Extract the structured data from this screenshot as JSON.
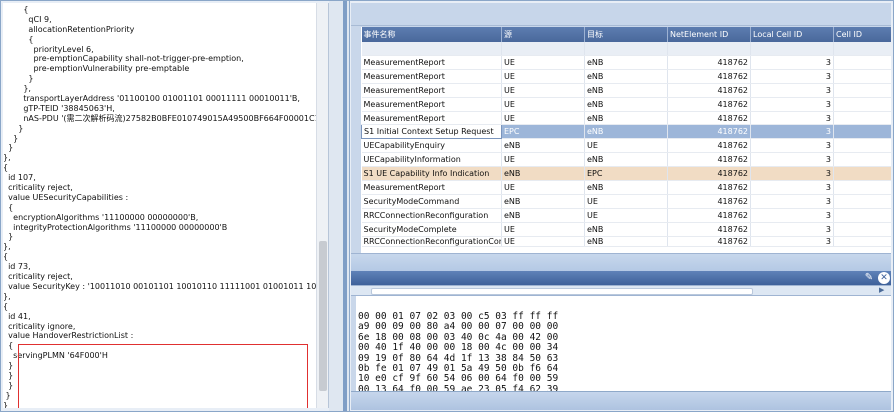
{
  "code_lines": [
    "        {",
    "          qCI 9,",
    "          allocationRetentionPriority",
    "          {",
    "            priorityLevel 6,",
    "            pre-emptionCapability shall-not-trigger-pre-emption,",
    "            pre-emptionVulnerability pre-emptable",
    "          }",
    "        },",
    "        transportLayerAddress '01100100 01001101 00011111 00010011'B,",
    "        gTP-TEID '38845063'H,",
    "        nAS-PDU '(需二次解析码流)27582B0BFE010749015A49500BF664F00001C11",
    "      }",
    "    }",
    "  }",
    "},",
    "{",
    "  id 107,",
    "  criticality reject,",
    "  value UESecurityCapabilities :",
    "  {",
    "    encryptionAlgorithms '11100000 00000000'B,",
    "    integrityProtectionAlgorithms '11100000 00000000'B",
    "  }",
    "},",
    "{",
    "  id 73,",
    "  criticality reject,",
    "  value SecurityKey : '10011010 00101101 10010110 11111001 01001011 101110",
    "},",
    "{",
    "  id 41,",
    "  criticality ignore,",
    "  value HandoverRestrictionList :",
    "  {",
    "    servingPLMN '64F000'H",
    "  }",
    "  }",
    "  }",
    " }",
    "}"
  ],
  "grid": {
    "headers": [
      "事件名称",
      "源",
      "目标",
      "NetElement ID",
      "Local Cell ID",
      "Cell ID"
    ],
    "rows": [
      [
        "MeasurementReport",
        "UE",
        "eNB",
        "418762",
        "3",
        ""
      ],
      [
        "MeasurementReport",
        "UE",
        "eNB",
        "418762",
        "3",
        ""
      ],
      [
        "MeasurementReport",
        "UE",
        "eNB",
        "418762",
        "3",
        ""
      ],
      [
        "MeasurementReport",
        "UE",
        "eNB",
        "418762",
        "3",
        ""
      ],
      [
        "MeasurementReport",
        "UE",
        "eNB",
        "418762",
        "3",
        ""
      ],
      [
        "S1 Initial Context Setup Request",
        "EPC",
        "eNB",
        "418762",
        "3",
        ""
      ],
      [
        "UECapabilityEnquiry",
        "eNB",
        "UE",
        "418762",
        "3",
        ""
      ],
      [
        "UECapabilityInformation",
        "UE",
        "eNB",
        "418762",
        "3",
        ""
      ],
      [
        "S1 UE Capability Info Indication",
        "eNB",
        "EPC",
        "418762",
        "3",
        ""
      ],
      [
        "MeasurementReport",
        "UE",
        "eNB",
        "418762",
        "3",
        ""
      ],
      [
        "SecurityModeCommand",
        "eNB",
        "UE",
        "418762",
        "3",
        ""
      ],
      [
        "RRCConnectionReconfiguration",
        "eNB",
        "UE",
        "418762",
        "3",
        ""
      ],
      [
        "SecurityModeComplete",
        "UE",
        "eNB",
        "418762",
        "3",
        ""
      ],
      [
        "RRCConnectionReconfigurationCompl",
        "UE",
        "eNB",
        "418762",
        "3",
        ""
      ]
    ],
    "selected_row": 5,
    "highlighted_row": 8
  },
  "hex_lines": [
    "00 00 01 07 02 03 00 c5 03 ff ff ff",
    "a9 00 09 00 80 a4 00 00 07 00 00 00",
    "6e 18 00 08 00 03 40 0c 4a 00 42 00",
    "00 40 1f 40 00 00 18 00 4c 00 00 34",
    "09 19 0f 80 64 4d 1f 13 38 84 50 63",
    "0b fe 01 07 49 01 5a 49 50 0b f6 64",
    "10 e0 cf 9f 60 54 06 00 64 f0 00 59",
    "00 13 64 f0 00 59 ae 23 05 f4 62 39"
  ],
  "icons": {
    "edit": "pencil-icon",
    "close": "close-icon"
  },
  "colors": {
    "header": "#5d7db0",
    "selected": "#9db6d9",
    "highlight": "#f1dcc4",
    "redbox": "#e03030"
  }
}
